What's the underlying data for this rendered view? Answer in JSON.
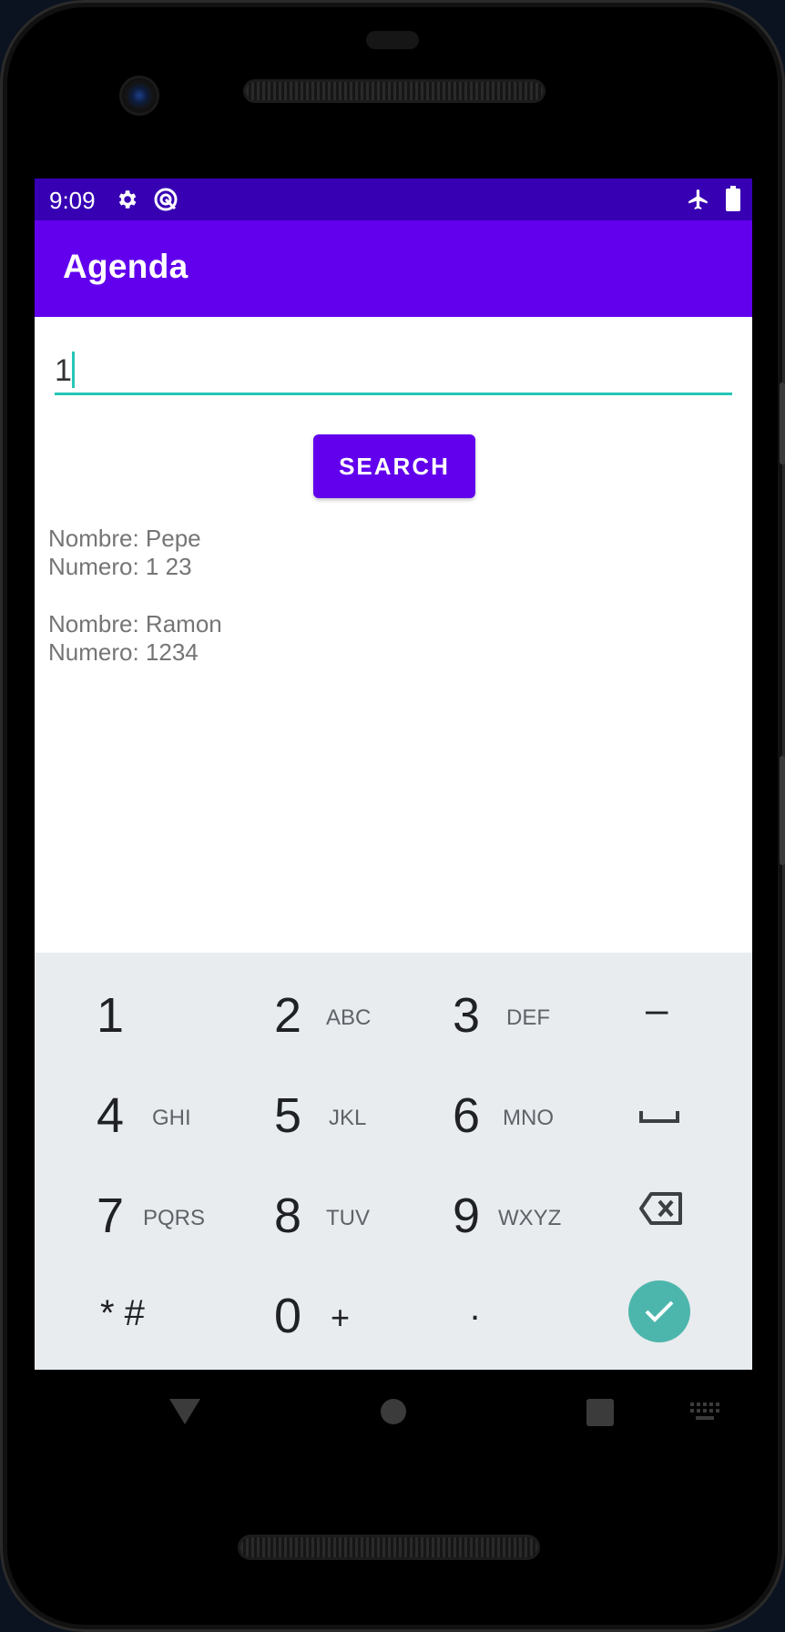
{
  "status_bar": {
    "time": "9:09",
    "icons": [
      "gear-icon",
      "sync-icon",
      "airplane-icon",
      "battery-icon"
    ]
  },
  "app_bar": {
    "title": "Agenda"
  },
  "search": {
    "value": "1"
  },
  "search_button": {
    "label": "SEARCH"
  },
  "results": [
    {
      "name_line": "Nombre: Pepe",
      "number_line": "Numero: 1 23"
    },
    {
      "name_line": "Nombre: Ramon",
      "number_line": "Numero: 1234"
    }
  ],
  "keyboard": {
    "keys": [
      {
        "main": "1",
        "sub": ""
      },
      {
        "main": "2",
        "sub": "ABC"
      },
      {
        "main": "3",
        "sub": "DEF"
      },
      {
        "main": "–",
        "sub": ""
      },
      {
        "main": "4",
        "sub": "GHI"
      },
      {
        "main": "5",
        "sub": "JKL"
      },
      {
        "main": "6",
        "sub": "MNO"
      },
      {
        "main": "",
        "sub": ""
      },
      {
        "main": "7",
        "sub": "PQRS"
      },
      {
        "main": "8",
        "sub": "TUV"
      },
      {
        "main": "9",
        "sub": "WXYZ"
      },
      {
        "main": "",
        "sub": ""
      },
      {
        "main": "* #",
        "sub": ""
      },
      {
        "main": "0",
        "sub": "+"
      },
      {
        "main": ".",
        "sub": ""
      },
      {
        "main": "",
        "sub": ""
      }
    ],
    "special_icons": [
      "space-icon",
      "backspace-icon",
      "done-check-icon"
    ],
    "accent": "#4db6ac"
  },
  "colors": {
    "primary": "#6200ee",
    "primary_dark": "#3700b3",
    "input_accent": "#26c6b7"
  },
  "nav_bar": {
    "icons": [
      "back-icon",
      "home-icon",
      "recents-icon",
      "keyboard-switch-icon"
    ]
  }
}
